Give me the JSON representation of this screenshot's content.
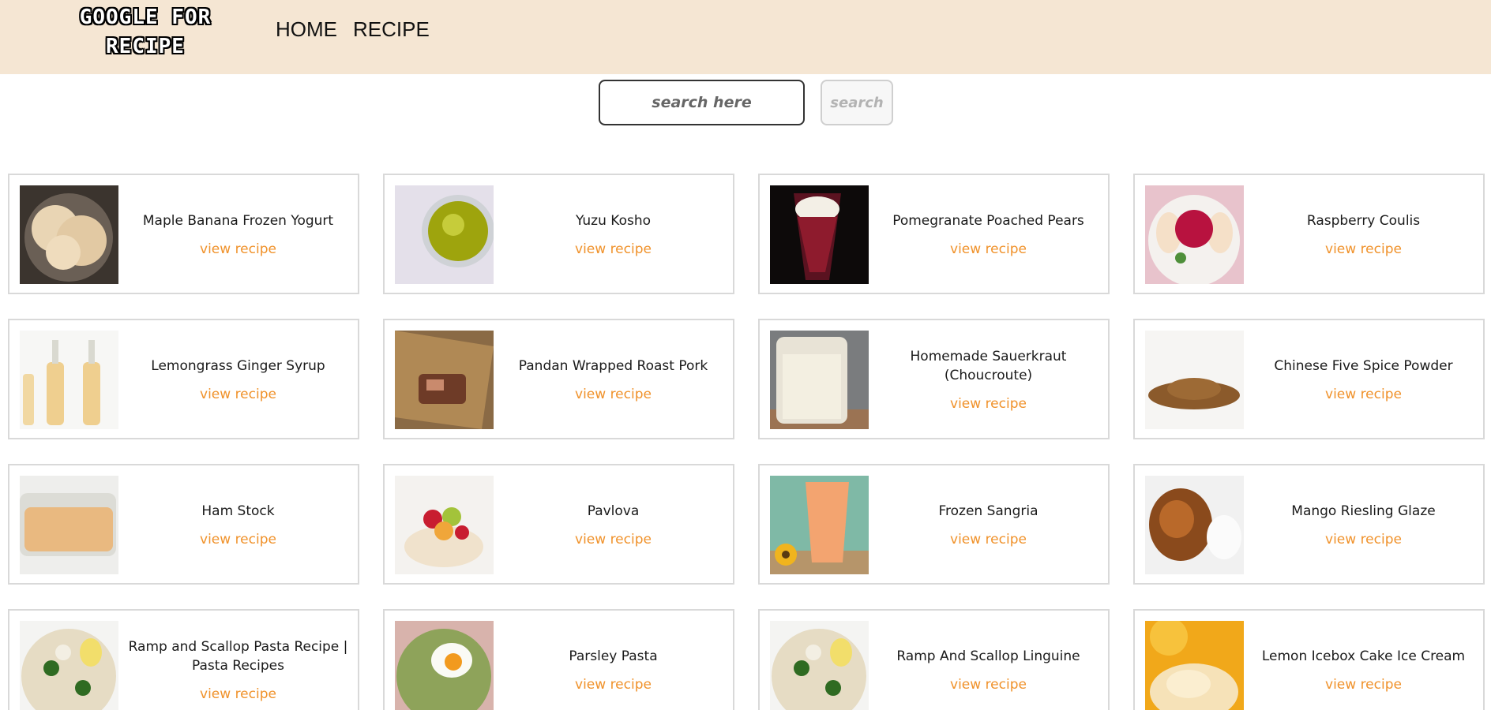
{
  "header": {
    "logo_line1": "GOOGLE FOR",
    "logo_line2": "RECIPE",
    "nav": {
      "home": "HOME",
      "recipe": "RECIPE"
    }
  },
  "search": {
    "placeholder": "search here",
    "value": "",
    "button": "search"
  },
  "colors": {
    "header_bg": "#f5e6d3",
    "link": "#f0922b",
    "card_border": "#d9d9d9"
  },
  "recipes": [
    {
      "title": "Maple Banana Frozen Yogurt",
      "link": "view recipe",
      "icon": "frozen-yogurt-image"
    },
    {
      "title": "Yuzu Kosho",
      "link": "view recipe",
      "icon": "yuzu-kosho-image"
    },
    {
      "title": "Pomegranate Poached Pears",
      "link": "view recipe",
      "icon": "poached-pears-image"
    },
    {
      "title": "Raspberry Coulis",
      "link": "view recipe",
      "icon": "raspberry-coulis-image"
    },
    {
      "title": "Lemongrass Ginger Syrup",
      "link": "view recipe",
      "icon": "ginger-syrup-image"
    },
    {
      "title": "Pandan Wrapped Roast Pork",
      "link": "view recipe",
      "icon": "roast-pork-image"
    },
    {
      "title": "Homemade Sauerkraut (Choucroute)",
      "link": "view recipe",
      "icon": "sauerkraut-image"
    },
    {
      "title": "Chinese Five Spice Powder",
      "link": "view recipe",
      "icon": "spice-powder-image"
    },
    {
      "title": "Ham Stock",
      "link": "view recipe",
      "icon": "ham-stock-image"
    },
    {
      "title": "Pavlova",
      "link": "view recipe",
      "icon": "pavlova-image"
    },
    {
      "title": "Frozen Sangria",
      "link": "view recipe",
      "icon": "frozen-sangria-image"
    },
    {
      "title": "Mango Riesling Glaze",
      "link": "view recipe",
      "icon": "mango-glaze-image"
    },
    {
      "title": "Ramp and Scallop Pasta Recipe | Pasta Recipes",
      "link": "view recipe",
      "icon": "scallop-pasta-image"
    },
    {
      "title": "Parsley Pasta",
      "link": "view recipe",
      "icon": "parsley-pasta-image"
    },
    {
      "title": "Ramp And Scallop Linguine",
      "link": "view recipe",
      "icon": "scallop-linguine-image"
    },
    {
      "title": "Lemon Icebox Cake Ice Cream",
      "link": "view recipe",
      "icon": "ice-cream-image"
    }
  ]
}
